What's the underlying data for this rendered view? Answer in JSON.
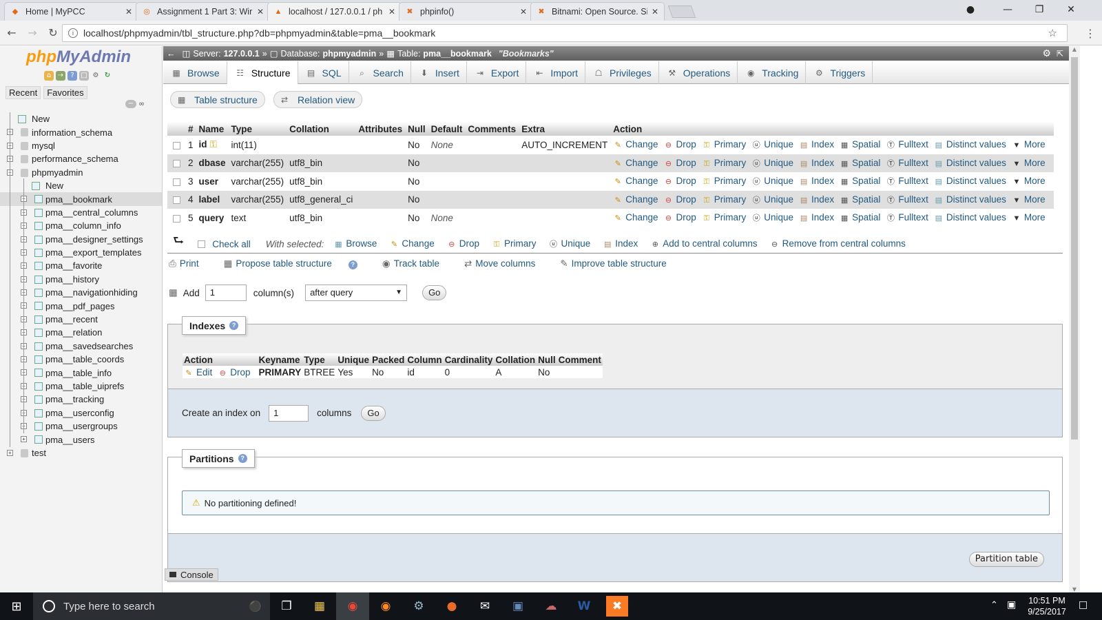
{
  "browser": {
    "tabs": [
      {
        "title": "Home | MyPCC",
        "favicon": "mypcc-icon"
      },
      {
        "title": "Assignment 1 Part 3: Wir",
        "favicon": "canvas-icon"
      },
      {
        "title": "localhost / 127.0.0.1 / ph",
        "favicon": "phpmyadmin-icon",
        "active": true
      },
      {
        "title": "phpinfo()",
        "favicon": "xampp-icon"
      },
      {
        "title": "Bitnami: Open Source. Si",
        "favicon": "bitnami-icon"
      }
    ],
    "url": "localhost/phpmyadmin/tbl_structure.php?db=phpmyadmin&table=pma__bookmark"
  },
  "sidebar": {
    "logo_php": "php",
    "logo_myadmin": "MyAdmin",
    "tabs": [
      "Recent",
      "Favorites"
    ],
    "tree": [
      {
        "label": "New",
        "level": 0,
        "type": "new"
      },
      {
        "label": "information_schema",
        "level": 0,
        "type": "db"
      },
      {
        "label": "mysql",
        "level": 0,
        "type": "db"
      },
      {
        "label": "performance_schema",
        "level": 0,
        "type": "db"
      },
      {
        "label": "phpmyadmin",
        "level": 0,
        "type": "db",
        "open": true
      },
      {
        "label": "New",
        "level": 1,
        "type": "new"
      },
      {
        "label": "pma__bookmark",
        "level": 1,
        "type": "table",
        "selected": true
      },
      {
        "label": "pma__central_columns",
        "level": 1,
        "type": "table"
      },
      {
        "label": "pma__column_info",
        "level": 1,
        "type": "table"
      },
      {
        "label": "pma__designer_settings",
        "level": 1,
        "type": "table"
      },
      {
        "label": "pma__export_templates",
        "level": 1,
        "type": "table"
      },
      {
        "label": "pma__favorite",
        "level": 1,
        "type": "table"
      },
      {
        "label": "pma__history",
        "level": 1,
        "type": "table"
      },
      {
        "label": "pma__navigationhiding",
        "level": 1,
        "type": "table"
      },
      {
        "label": "pma__pdf_pages",
        "level": 1,
        "type": "table"
      },
      {
        "label": "pma__recent",
        "level": 1,
        "type": "table"
      },
      {
        "label": "pma__relation",
        "level": 1,
        "type": "table"
      },
      {
        "label": "pma__savedsearches",
        "level": 1,
        "type": "table"
      },
      {
        "label": "pma__table_coords",
        "level": 1,
        "type": "table"
      },
      {
        "label": "pma__table_info",
        "level": 1,
        "type": "table"
      },
      {
        "label": "pma__table_uiprefs",
        "level": 1,
        "type": "table"
      },
      {
        "label": "pma__tracking",
        "level": 1,
        "type": "table"
      },
      {
        "label": "pma__userconfig",
        "level": 1,
        "type": "table"
      },
      {
        "label": "pma__usergroups",
        "level": 1,
        "type": "table"
      },
      {
        "label": "pma__users",
        "level": 1,
        "type": "table"
      },
      {
        "label": "test",
        "level": 0,
        "type": "db"
      }
    ]
  },
  "breadcrumb": {
    "server_label": "Server:",
    "server": "127.0.0.1",
    "database_label": "Database:",
    "database": "phpmyadmin",
    "table_label": "Table:",
    "table": "pma__bookmark",
    "comment": "\"Bookmarks\""
  },
  "menu_tabs": [
    "Browse",
    "Structure",
    "SQL",
    "Search",
    "Insert",
    "Export",
    "Import",
    "Privileges",
    "Operations",
    "Tracking",
    "Triggers"
  ],
  "sub_tabs": [
    "Table structure",
    "Relation view"
  ],
  "structure": {
    "headers": [
      "#",
      "Name",
      "Type",
      "Collation",
      "Attributes",
      "Null",
      "Default",
      "Comments",
      "Extra",
      "Action"
    ],
    "rows": [
      {
        "num": "1",
        "name": "id",
        "type": "int(11)",
        "collation": "",
        "attributes": "",
        "null": "No",
        "default": "None",
        "comments": "",
        "extra": "AUTO_INCREMENT",
        "primary_key": true
      },
      {
        "num": "2",
        "name": "dbase",
        "type": "varchar(255)",
        "collation": "utf8_bin",
        "attributes": "",
        "null": "No",
        "default": "",
        "comments": "",
        "extra": ""
      },
      {
        "num": "3",
        "name": "user",
        "type": "varchar(255)",
        "collation": "utf8_bin",
        "attributes": "",
        "null": "No",
        "default": "",
        "comments": "",
        "extra": ""
      },
      {
        "num": "4",
        "name": "label",
        "type": "varchar(255)",
        "collation": "utf8_general_ci",
        "attributes": "",
        "null": "No",
        "default": "",
        "comments": "",
        "extra": ""
      },
      {
        "num": "5",
        "name": "query",
        "type": "text",
        "collation": "utf8_bin",
        "attributes": "",
        "null": "No",
        "default": "None",
        "comments": "",
        "extra": ""
      }
    ],
    "row_actions": [
      "Change",
      "Drop",
      "Primary",
      "Unique",
      "Index",
      "Spatial",
      "Fulltext",
      "Distinct values",
      "More"
    ]
  },
  "with_selected": {
    "check_all": "Check all",
    "label": "With selected:",
    "actions": [
      "Browse",
      "Change",
      "Drop",
      "Primary",
      "Unique",
      "Index",
      "Add to central columns",
      "Remove from central columns"
    ]
  },
  "tools": [
    "Print",
    "Propose table structure",
    "Track table",
    "Move columns",
    "Improve table structure"
  ],
  "add_column": {
    "label": "Add",
    "count": "1",
    "unit": "column(s)",
    "position": "after query",
    "go": "Go"
  },
  "indexes": {
    "legend": "Indexes",
    "headers": [
      "Action",
      "Keyname",
      "Type",
      "Unique",
      "Packed",
      "Column",
      "Cardinality",
      "Collation",
      "Null",
      "Comment"
    ],
    "rows": [
      {
        "edit": "Edit",
        "drop": "Drop",
        "keyname": "PRIMARY",
        "type": "BTREE",
        "unique": "Yes",
        "packed": "No",
        "column": "id",
        "cardinality": "0",
        "collation": "A",
        "null": "No",
        "comment": ""
      }
    ],
    "create_label": "Create an index on",
    "create_count": "1",
    "create_unit": "columns",
    "go": "Go"
  },
  "partitions": {
    "legend": "Partitions",
    "notice": "No partitioning defined!",
    "button": "Partition table"
  },
  "console": "Console",
  "taskbar": {
    "search_placeholder": "Type here to search",
    "time": "10:51 PM",
    "date": "9/25/2017"
  }
}
